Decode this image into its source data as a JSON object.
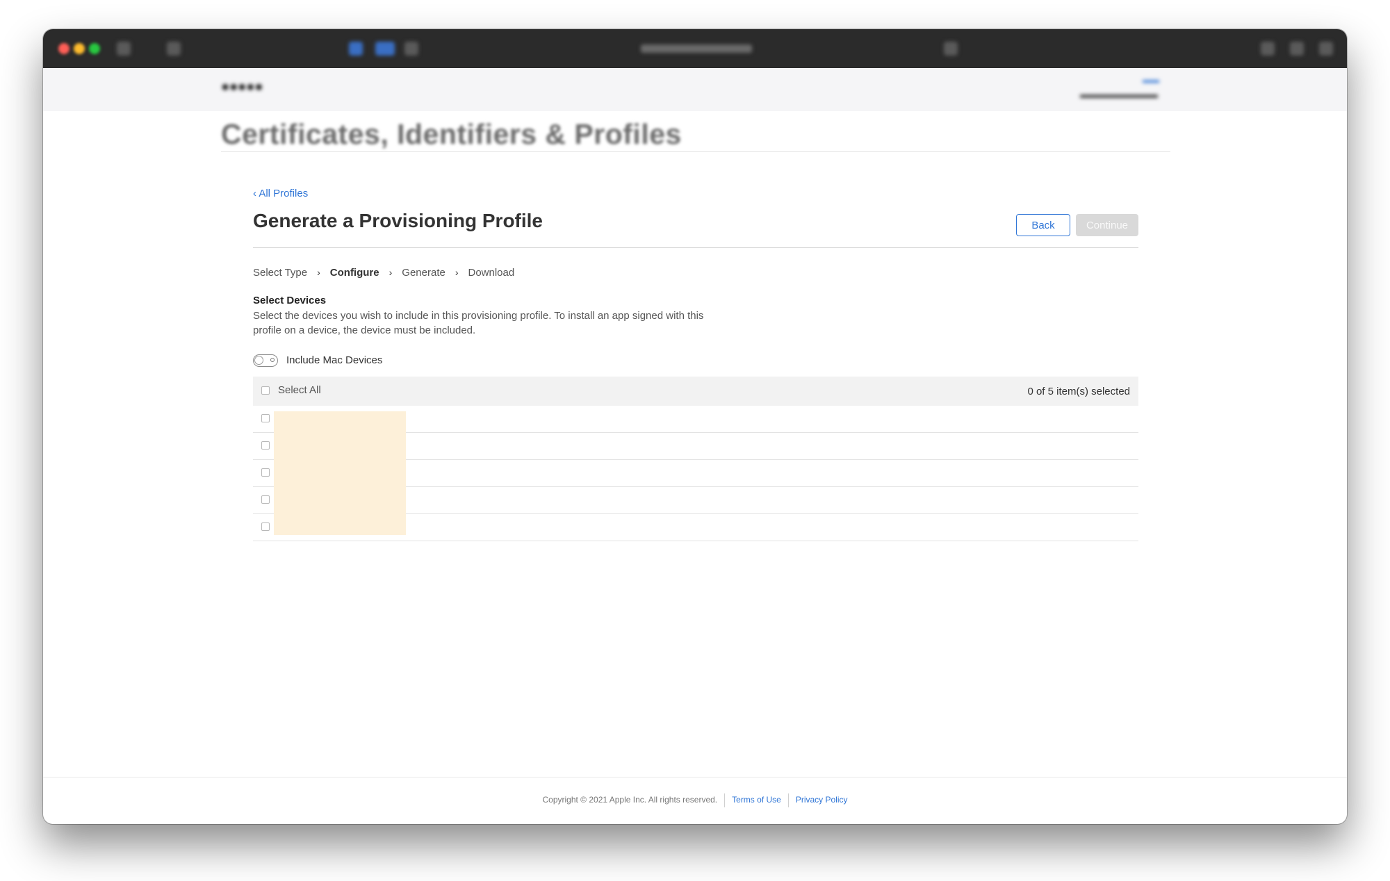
{
  "header": {
    "page_title": "Certificates, Identifiers & Profiles"
  },
  "breadcrumb": {
    "back_link": "‹ All Profiles"
  },
  "main": {
    "title": "Generate a Provisioning Profile",
    "back_button": "Back",
    "continue_button": "Continue"
  },
  "steps": [
    {
      "label": "Select Type",
      "active": false
    },
    {
      "label": "Configure",
      "active": true
    },
    {
      "label": "Generate",
      "active": false
    },
    {
      "label": "Download",
      "active": false
    }
  ],
  "step_separator": "›",
  "devices": {
    "section_title": "Select Devices",
    "description": "Select the devices you wish to include in this provisioning profile. To install an app signed with this profile on a device, the device must be included.",
    "toggle_label": "Include Mac Devices",
    "toggle_on": false,
    "select_all_label": "Select All",
    "selected_count": "0 of 5 item(s) selected"
  },
  "footer": {
    "copyright": "Copyright © 2021 Apple Inc. All rights reserved.",
    "terms": "Terms of Use",
    "privacy": "Privacy Policy"
  },
  "colors": {
    "accent": "#2f75d6",
    "titlebar": "#2b2b2b",
    "redaction": "#fdf0d9"
  }
}
